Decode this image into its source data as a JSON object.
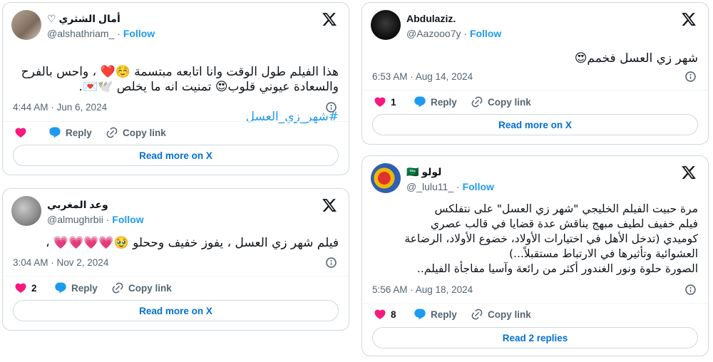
{
  "tweets": [
    {
      "name": "أمال الشثري ♡",
      "handle": "@alshathriam_",
      "follow": "Follow",
      "text": "هذا الفيلم طول الوقت وانا اتابعه مبتسمة ☺️❤️ ، واحس بالفرح والسعادة عيوني قلوب😍 تمنيت انه ما يخلص 🕊️💌.",
      "hashtag": "#شهر_زي_العسل",
      "timestamp": "4:44 AM · Jun 6, 2024",
      "like_count": "",
      "reply_label": "Reply",
      "copy_label": "Copy link",
      "cta": "Read more on X"
    },
    {
      "name": "وعد المغربي",
      "handle": "@almughrbii",
      "follow": "Follow",
      "text": "فيلم شهر زي العسل ، يفوز خفيف وححلو 🥹💗💗💗💗 ،",
      "timestamp": "3:04 AM · Nov 2, 2024",
      "like_count": "2",
      "reply_label": "Reply",
      "copy_label": "Copy link",
      "cta": "Read more on X"
    },
    {
      "name": "Abdulaziz.",
      "handle": "@Aazooo7y",
      "follow": "Follow",
      "text": "شهر زي العسل فخمم😍",
      "timestamp": "6:53 AM · Aug 14, 2024",
      "like_count": "1",
      "reply_label": "Reply",
      "copy_label": "Copy link",
      "cta": "Read more on X"
    },
    {
      "name": "لولو 🇸🇦",
      "handle": "@_lulu11_",
      "follow": "Follow",
      "text": "مرة حبيت الفيلم الخليجي \"شهر زي العسل\" على نتفلكس\nفيلم خفيف لطيف مبهج يناقش عدة قضايا في قالب عصري\nكوميدي (تدخل الأهل في اختيارات الأولاد، خضوع الأولاد، الرضاعة\nالعشوائية وتأثيرها في الارتباط مستقبلاً...)\nالصورة حلوة ونور الغندور أكثر من رائعة وآسيا مفاجأة الفيلم..",
      "timestamp": "5:56 AM · Aug 18, 2024",
      "like_count": "8",
      "reply_label": "Reply",
      "copy_label": "Copy link",
      "cta": "Read 2 replies"
    }
  ],
  "colors": {
    "like": "#f91880",
    "reply": "#1d9bf0",
    "link": "#1d9bf0",
    "cta": "#006fd6"
  },
  "icons": [
    "x-logo-icon",
    "heart-icon",
    "reply-bubble-icon",
    "link-icon",
    "info-icon"
  ]
}
